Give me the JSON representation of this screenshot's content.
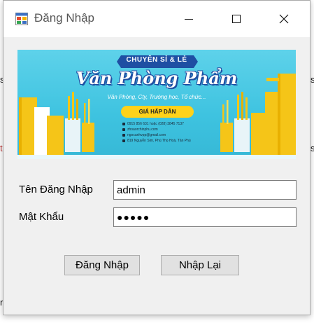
{
  "background_fragments": [
    "s",
    "s",
    "t",
    "s",
    "r"
  ],
  "window": {
    "title": "Đăng Nhập",
    "app_icon": "forms-app-icon",
    "controls": {
      "minimize": "minimize-icon",
      "maximize": "maximize-icon",
      "close": "close-icon"
    }
  },
  "banner": {
    "headline": "CHUYÊN SỈ & LẺ",
    "title": "Văn Phòng Phẩm",
    "subtitle": "Văn Phòng, Cty, Trường học, Tổ chức...",
    "badge": "GIÁ HẤP DẪN",
    "contacts": [
      "0915 856 631 hoặc (028) 3845 7137",
      "zhoaorchinphu.com",
      "ngocanhvpp@gmail.com",
      "819 Nguyễn Sim, Phú Thọ Hoà, Tân Phú"
    ]
  },
  "form": {
    "username_label": "Tên Đăng Nhập",
    "username_value": "admin",
    "password_label": "Mật Khẩu",
    "password_masked": "●●●●●"
  },
  "buttons": {
    "login": "Đăng Nhập",
    "reset": "Nhập Lại"
  },
  "colors": {
    "window_bg": "#f0f0f0",
    "banner_blue": "#3ec3e0",
    "title_blue": "#1e4fa3",
    "badge_yellow": "#ffd21a",
    "book_yellow": "#f5c518"
  }
}
